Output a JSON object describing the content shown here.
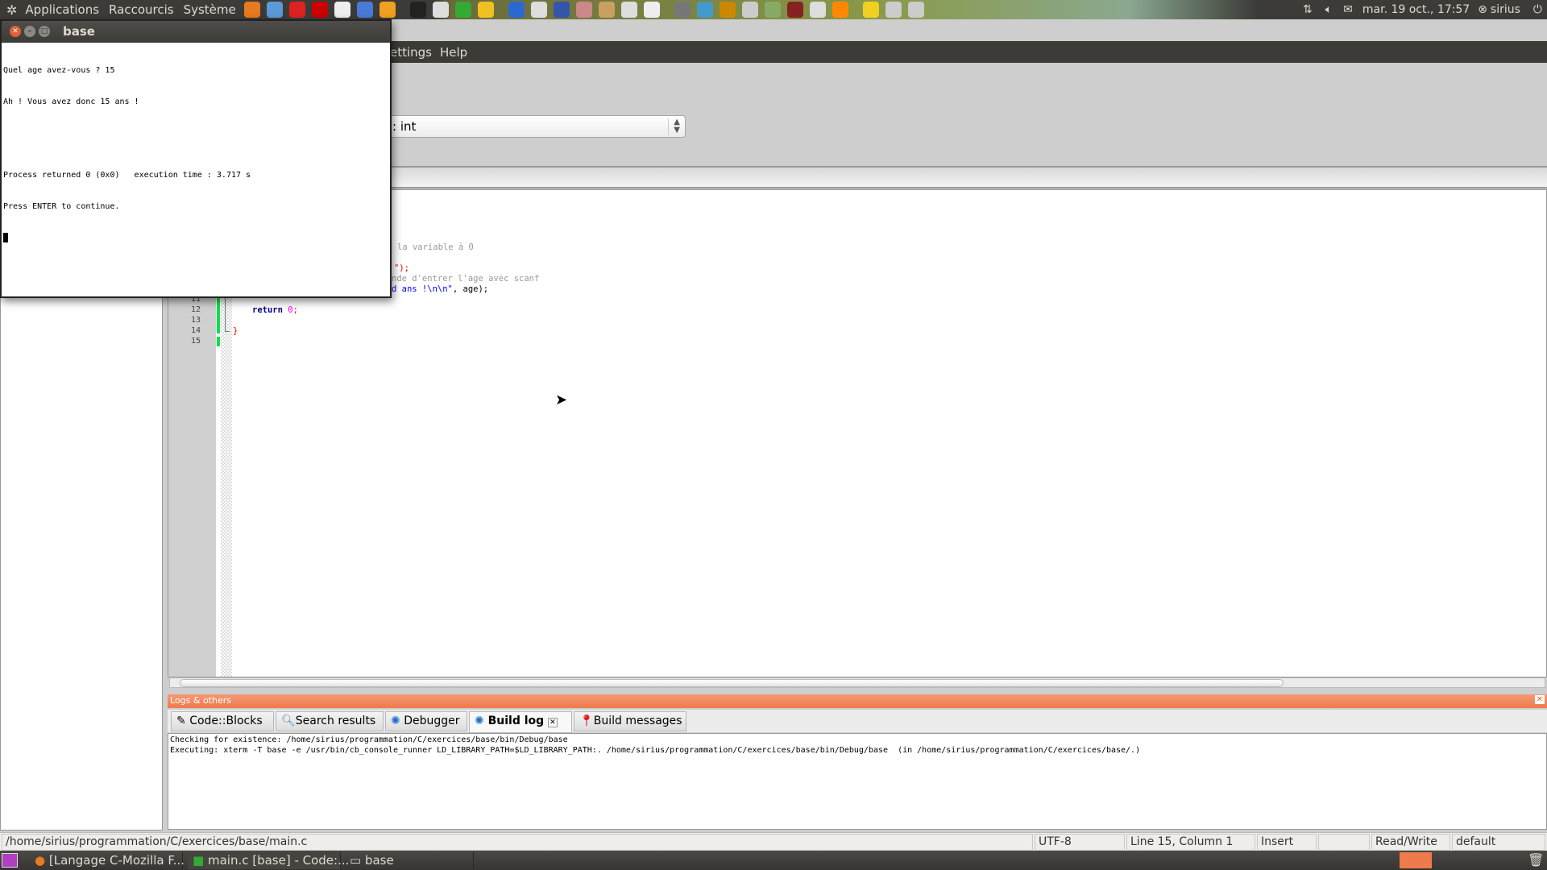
{
  "top_panel": {
    "menus": [
      "Applications",
      "Raccourcis",
      "Système"
    ],
    "datetime": "mar. 19 oct., 17:57",
    "user": "sirius",
    "launchers": [
      "firefox-icon",
      "settings-icon",
      "opera-icon",
      "filezilla-icon",
      "editor-icon",
      "qbittorrent-icon",
      "xchat-icon",
      "terminal-icon",
      "gedit-icon",
      "codeblocks-icon",
      "python-icon",
      "kde-icon",
      "tex-icon",
      "globe-icon",
      "font-icon",
      "archive-icon",
      "geometry-icon",
      "chart-icon",
      "gimp-icon",
      "photos-icon",
      "paint-icon",
      "brushes-icon",
      "music-icon",
      "radio-icon",
      "disk-icon",
      "vlc-icon",
      "notes-icon",
      "gears-icon",
      "script-icon"
    ]
  },
  "codeblocks": {
    "menu_visible": [
      "ettings",
      "Help"
    ],
    "function_combo": ": int",
    "code_fragments": {
      "line6": "la variable à 0",
      "line8": "\");",
      "line9": "nde d'entrer l'age avec scanf",
      "line10a": "d ans !\\n\\n\"",
      "line10b": ", age);",
      "line12_kw": "return",
      "line12_num": "0",
      "line12_end": ";",
      "line14": "}"
    },
    "line_numbers": [
      "11",
      "12",
      "13",
      "14",
      "15"
    ],
    "logs": {
      "title": "Logs & others",
      "tabs": [
        "Code::Blocks",
        "Search results",
        "Debugger",
        "Build log",
        "Build messages"
      ],
      "active_tab": "Build log",
      "lines": [
        "Checking for existence: /home/sirius/programmation/C/exercices/base/bin/Debug/base",
        "Executing: xterm -T base -e /usr/bin/cb_console_runner LD_LIBRARY_PATH=$LD_LIBRARY_PATH:. /home/sirius/programmation/C/exercices/base/bin/Debug/base  (in /home/sirius/programmation/C/exercices/base/.)"
      ]
    },
    "status": {
      "path": "/home/sirius/programmation/C/exercices/base/main.c",
      "encoding": "UTF-8",
      "position": "Line 15, Column 1",
      "mode": "Insert",
      "access": "Read/Write",
      "profile": "default"
    }
  },
  "terminal": {
    "title": "base",
    "lines": [
      "Quel age avez-vous ? 15",
      "Ah ! Vous avez donc 15 ans !",
      "",
      "",
      "Process returned 0 (0x0)   execution time : 3.717 s",
      "Press ENTER to continue."
    ]
  },
  "taskbar": {
    "items": [
      "[Langage C-Mozilla F...",
      "main.c [base] - Code:...",
      "base"
    ]
  },
  "colors": {
    "logs_header": "#ef7a4c",
    "panel": "#3c3b37",
    "change_bar": "#0ee04a"
  }
}
